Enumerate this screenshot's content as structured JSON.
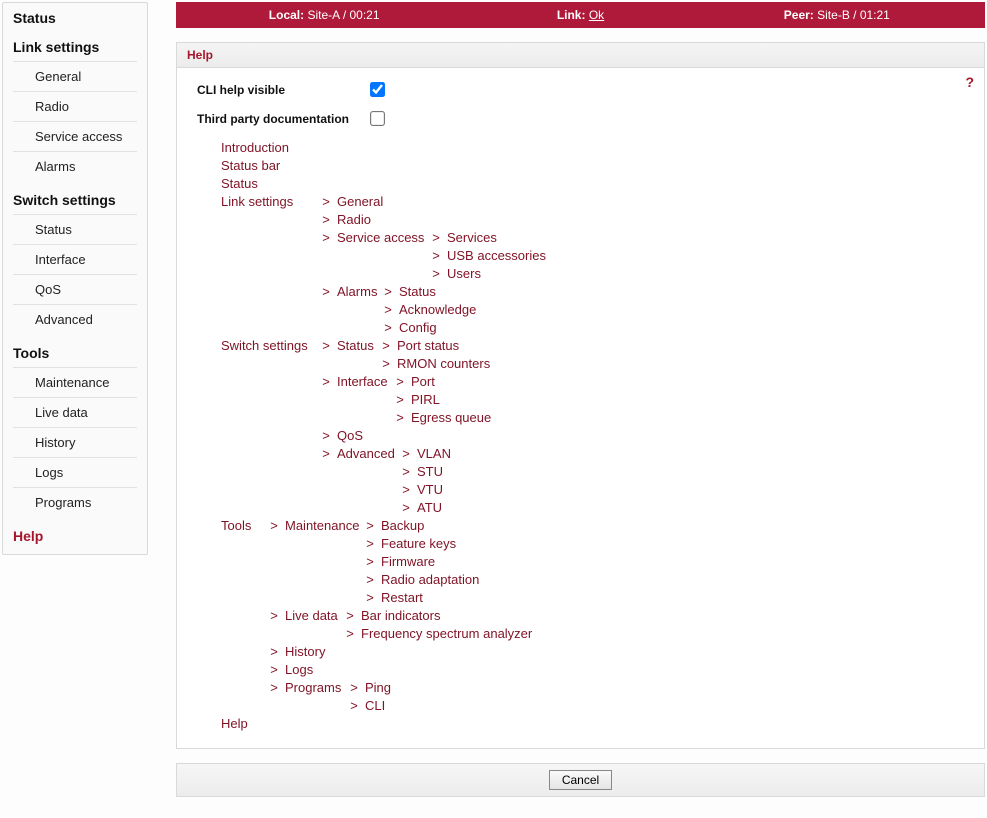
{
  "statusbar": {
    "local_label": "Local:",
    "local_value": "Site-A / 00:21",
    "link_label": "Link:",
    "link_value": "Ok",
    "peer_label": "Peer:",
    "peer_value": "Site-B / 01:21"
  },
  "sidebar": {
    "status_label": "Status",
    "link_settings_label": "Link settings",
    "link_settings_items": [
      "General",
      "Radio",
      "Service access",
      "Alarms"
    ],
    "switch_settings_label": "Switch settings",
    "switch_settings_items": [
      "Status",
      "Interface",
      "QoS",
      "Advanced"
    ],
    "tools_label": "Tools",
    "tools_items": [
      "Maintenance",
      "Live data",
      "History",
      "Logs",
      "Programs"
    ],
    "help_label": "Help"
  },
  "panel": {
    "title": "Help",
    "help_icon": "?",
    "cli_help_label": "CLI help visible",
    "cli_help_checked": true,
    "third_party_label": "Third party documentation",
    "third_party_checked": false
  },
  "tree": {
    "gt": ">",
    "introduction": "Introduction",
    "status_bar": "Status bar",
    "status": "Status",
    "link_settings": "Link settings",
    "ls_general": "General",
    "ls_radio": "Radio",
    "ls_service_access": "Service access",
    "sa_services": "Services",
    "sa_usb": "USB accessories",
    "sa_users": "Users",
    "ls_alarms": "Alarms",
    "al_status": "Status",
    "al_ack": "Acknowledge",
    "al_config": "Config",
    "switch_settings": "Switch settings",
    "ss_status": "Status",
    "st_port_status": "Port status",
    "st_rmon": "RMON counters",
    "ss_interface": "Interface",
    "if_port": "Port",
    "if_pirl": "PIRL",
    "if_egress": "Egress queue",
    "ss_qos": "QoS",
    "ss_advanced": "Advanced",
    "ad_vlan": "VLAN",
    "ad_stu": "STU",
    "ad_vtu": "VTU",
    "ad_atu": "ATU",
    "tools": "Tools",
    "t_maintenance": "Maintenance",
    "m_backup": "Backup",
    "m_feature": "Feature keys",
    "m_firmware": "Firmware",
    "m_radio_adapt": "Radio adaptation",
    "m_restart": "Restart",
    "t_livedata": "Live data",
    "ld_bar": "Bar indicators",
    "ld_freq": "Frequency spectrum analyzer",
    "t_history": "History",
    "t_logs": "Logs",
    "t_programs": "Programs",
    "p_ping": "Ping",
    "p_cli": "CLI",
    "help": "Help"
  },
  "bottom": {
    "cancel": "Cancel"
  }
}
